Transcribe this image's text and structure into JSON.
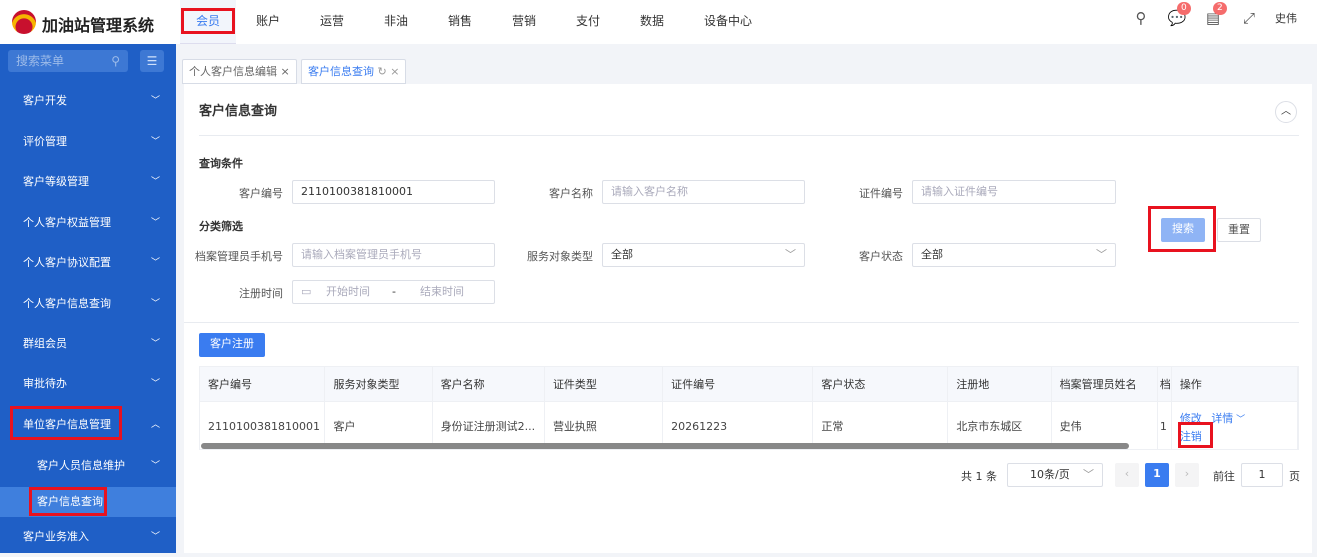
{
  "app": {
    "title": "加油站管理系统",
    "user": "史伟"
  },
  "nav": [
    "会员",
    "账户",
    "运营",
    "非油",
    "销售",
    "营销",
    "支付",
    "数据",
    "设备中心"
  ],
  "badges": {
    "messages": "0",
    "tasks": "2"
  },
  "sidebar": {
    "search_placeholder": "搜索菜单",
    "items": [
      "客户开发",
      "评价管理",
      "客户等级管理",
      "个人客户权益管理",
      "个人客户协议配置",
      "个人客户信息查询",
      "群组会员",
      "审批待办",
      "单位客户信息管理"
    ],
    "sub_items": [
      "客户人员信息维护",
      "客户信息查询",
      "客户业务准入"
    ]
  },
  "tabs": [
    "个人客户信息编辑",
    "客户信息查询"
  ],
  "page": {
    "title": "客户信息查询",
    "query_section": "查询条件",
    "filter_section": "分类筛选"
  },
  "form": {
    "customer_no": {
      "label": "客户编号",
      "value": "2110100381810001"
    },
    "customer_name": {
      "label": "客户名称",
      "placeholder": "请输入客户名称"
    },
    "cert_no": {
      "label": "证件编号",
      "placeholder": "请输入证件编号"
    },
    "manager_phone": {
      "label": "档案管理员手机号",
      "placeholder": "请输入档案管理员手机号"
    },
    "service_type": {
      "label": "服务对象类型",
      "value": "全部"
    },
    "status": {
      "label": "客户状态",
      "value": "全部"
    },
    "reg_time": {
      "label": "注册时间",
      "start": "开始时间",
      "sep": "-",
      "end": "结束时间"
    },
    "search": "搜索",
    "reset": "重置"
  },
  "register_button": "客户注册",
  "table": {
    "headers": [
      "客户编号",
      "服务对象类型",
      "客户名称",
      "证件类型",
      "证件编号",
      "客户状态",
      "注册地",
      "档案管理员姓名",
      "档",
      "操作"
    ],
    "rows": [
      [
        "2110100381810001",
        "客户",
        "身份证注册测试2...",
        "营业执照",
        "20261223",
        "正常",
        "北京市东城区",
        "史伟",
        "1"
      ]
    ],
    "actions": {
      "edit": "修改",
      "detail": "详情",
      "cancel": "注销"
    }
  },
  "pagination": {
    "total": "共 1 条",
    "page_size": "10条/页",
    "current": "1",
    "goto": "前往",
    "goto_value": "1",
    "page_unit": "页"
  }
}
